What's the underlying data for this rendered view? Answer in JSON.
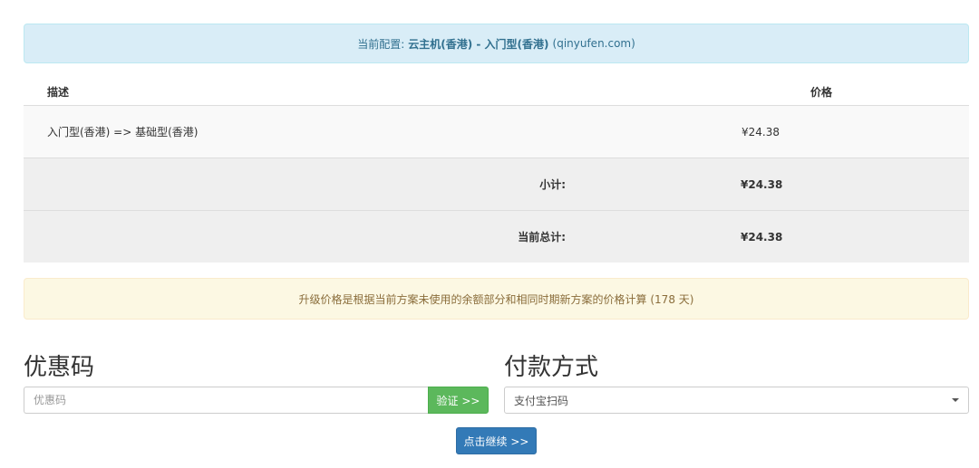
{
  "config": {
    "prefix": "当前配置:",
    "product": "云主机(香港) - 入门型(香港)",
    "domain": "(qinyufen.com)"
  },
  "table": {
    "headers": {
      "desc": "描述",
      "price": "价格"
    },
    "item": {
      "desc": "入门型(香港) => 基础型(香港)",
      "price": "¥24.38"
    },
    "subtotal": {
      "label": "小计:",
      "value": "¥24.38"
    },
    "total": {
      "label": "当前总计:",
      "value": "¥24.38"
    }
  },
  "notice": "升级价格是根据当前方案未使用的余额部分和相同时期新方案的价格计算 (178 天)",
  "promo": {
    "title": "优惠码",
    "placeholder": "优惠码",
    "button": "验证 >>"
  },
  "payment": {
    "title": "付款方式",
    "selected": "支付宝扫码"
  },
  "continue_button": "点击继续 >>"
}
